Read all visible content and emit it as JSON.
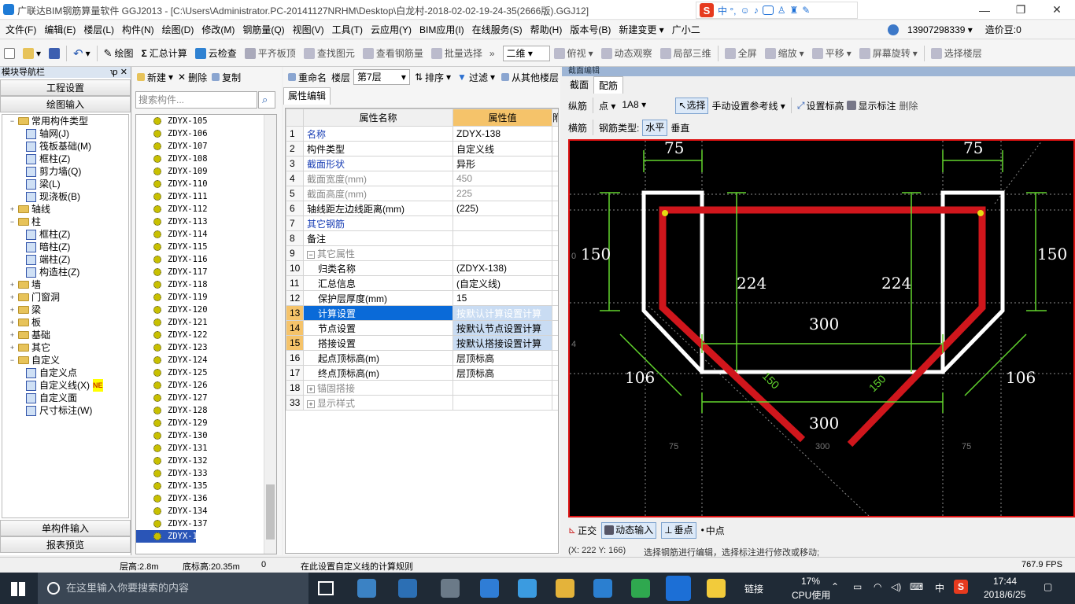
{
  "window": {
    "title": "广联达BIM钢筋算量软件 GGJ2013 - [C:\\Users\\Administrator.PC-20141127NRHM\\Desktop\\白龙村-2018-02-02-19-24-35(2666版).GGJ12]",
    "ime": "中 °,",
    "min": "—",
    "max": "❐",
    "close": "✕"
  },
  "menu": [
    "文件(F)",
    "编辑(E)",
    "楼层(L)",
    "构件(N)",
    "绘图(D)",
    "修改(M)",
    "钢筋量(Q)",
    "视图(V)",
    "工具(T)",
    "云应用(Y)",
    "BIM应用(I)",
    "在线服务(S)",
    "帮助(H)",
    "版本号(B)",
    "新建变更 ▾",
    "广小二"
  ],
  "menu_right": {
    "phone": "13907298339 ▾",
    "price": "造价豆:0"
  },
  "toolbar": {
    "draw": "绘图",
    "sum": "汇总计算",
    "cloud": "云检查",
    "flat": "平齐板顶",
    "find": "查找图元",
    "view_rebar": "查看钢筋量",
    "batch": "批量选择",
    "mode": "二维",
    "top": "俯视",
    "dyn": "动态观察",
    "local3d": "局部三维",
    "full": "全屏",
    "zoom": "缩放",
    "pan": "平移",
    "rotate": "屏幕旋转",
    "select_floor": "选择楼层"
  },
  "nav": {
    "title": "模块导航栏",
    "pin": "ꝕ ✕",
    "proj": "工程设置",
    "draw": "绘图输入",
    "single": "单构件输入",
    "report": "报表预览",
    "tree": [
      {
        "lvl": 0,
        "pm": "−",
        "label": "常用构件类型",
        "type": "folder"
      },
      {
        "lvl": 1,
        "label": "轴网(J)",
        "type": "comp"
      },
      {
        "lvl": 1,
        "label": "筏板基础(M)",
        "type": "comp"
      },
      {
        "lvl": 1,
        "label": "框柱(Z)",
        "type": "comp"
      },
      {
        "lvl": 1,
        "label": "剪力墙(Q)",
        "type": "comp"
      },
      {
        "lvl": 1,
        "label": "梁(L)",
        "type": "comp"
      },
      {
        "lvl": 1,
        "label": "现浇板(B)",
        "type": "comp"
      },
      {
        "lvl": 0,
        "pm": "+",
        "label": "轴线",
        "type": "folder"
      },
      {
        "lvl": 0,
        "pm": "−",
        "label": "柱",
        "type": "folder"
      },
      {
        "lvl": 1,
        "label": "框柱(Z)",
        "type": "comp"
      },
      {
        "lvl": 1,
        "label": "暗柱(Z)",
        "type": "comp"
      },
      {
        "lvl": 1,
        "label": "端柱(Z)",
        "type": "comp"
      },
      {
        "lvl": 1,
        "label": "构造柱(Z)",
        "type": "comp"
      },
      {
        "lvl": 0,
        "pm": "+",
        "label": "墙",
        "type": "folder"
      },
      {
        "lvl": 0,
        "pm": "+",
        "label": "门窗洞",
        "type": "folder"
      },
      {
        "lvl": 0,
        "pm": "+",
        "label": "梁",
        "type": "folder"
      },
      {
        "lvl": 0,
        "pm": "+",
        "label": "板",
        "type": "folder"
      },
      {
        "lvl": 0,
        "pm": "+",
        "label": "基础",
        "type": "folder"
      },
      {
        "lvl": 0,
        "pm": "+",
        "label": "其它",
        "type": "folder"
      },
      {
        "lvl": 0,
        "pm": "−",
        "label": "自定义",
        "type": "folder"
      },
      {
        "lvl": 1,
        "label": "自定义点",
        "type": "comp"
      },
      {
        "lvl": 1,
        "label": "自定义线(X)",
        "type": "comp",
        "badge": "NE"
      },
      {
        "lvl": 1,
        "label": "自定义面",
        "type": "comp"
      },
      {
        "lvl": 1,
        "label": "尺寸标注(W)",
        "type": "comp"
      }
    ]
  },
  "list": {
    "new": "新建",
    "del": "删除",
    "copy": "复制",
    "rename": "重命名",
    "floor_label": "楼层",
    "floor": "第7层",
    "sort": "排序",
    "filter": "过滤",
    "from_other": "从其他楼层",
    "search_placeholder": "搜索构件...",
    "items": [
      "ZDYX-105",
      "ZDYX-106",
      "ZDYX-107",
      "ZDYX-108",
      "ZDYX-109",
      "ZDYX-110",
      "ZDYX-111",
      "ZDYX-112",
      "ZDYX-113",
      "ZDYX-114",
      "ZDYX-115",
      "ZDYX-116",
      "ZDYX-117",
      "ZDYX-118",
      "ZDYX-119",
      "ZDYX-120",
      "ZDYX-121",
      "ZDYX-122",
      "ZDYX-123",
      "ZDYX-124",
      "ZDYX-125",
      "ZDYX-126",
      "ZDYX-127",
      "ZDYX-128",
      "ZDYX-129",
      "ZDYX-130",
      "ZDYX-131",
      "ZDYX-132",
      "ZDYX-133",
      "ZDYX-135",
      "ZDYX-136",
      "ZDYX-134",
      "ZDYX-137",
      "ZDYX-138"
    ],
    "selected": "ZDYX-138"
  },
  "props": {
    "tab": "属性编辑",
    "col_name": "属性名称",
    "col_val": "属性值",
    "col_extra": "附",
    "rows": [
      {
        "n": "1",
        "name": "名称",
        "val": "ZDYX-138",
        "cls": "blue"
      },
      {
        "n": "2",
        "name": "构件类型",
        "val": "自定义线"
      },
      {
        "n": "3",
        "name": "截面形状",
        "val": "异形",
        "cls": "blue"
      },
      {
        "n": "4",
        "name": "截面宽度(mm)",
        "val": "450",
        "cls": "grayt"
      },
      {
        "n": "5",
        "name": "截面高度(mm)",
        "val": "225",
        "cls": "grayt"
      },
      {
        "n": "6",
        "name": "轴线距左边线距离(mm)",
        "val": "(225)"
      },
      {
        "n": "7",
        "name": "其它钢筋",
        "val": "",
        "cls": "blue"
      },
      {
        "n": "8",
        "name": "备注",
        "val": ""
      },
      {
        "n": "9",
        "name": "其它属性",
        "val": "",
        "pm": "−",
        "cls": "grayt"
      },
      {
        "n": "10",
        "name": "归类名称",
        "val": "(ZDYX-138)",
        "indent": true
      },
      {
        "n": "11",
        "name": "汇总信息",
        "val": "(自定义线)",
        "indent": true
      },
      {
        "n": "12",
        "name": "保护层厚度(mm)",
        "val": "15",
        "indent": true
      },
      {
        "n": "13",
        "name": "计算设置",
        "val": "按默认计算设置计算",
        "indent": true,
        "sel": true,
        "hl": true
      },
      {
        "n": "14",
        "name": "节点设置",
        "val": "按默认节点设置计算",
        "indent": true,
        "hl": true
      },
      {
        "n": "15",
        "name": "搭接设置",
        "val": "按默认搭接设置计算",
        "indent": true,
        "hl": true
      },
      {
        "n": "16",
        "name": "起点顶标高(m)",
        "val": "层顶标高",
        "indent": true
      },
      {
        "n": "17",
        "name": "终点顶标高(m)",
        "val": "层顶标高",
        "indent": true
      },
      {
        "n": "18",
        "name": "锚固搭接",
        "val": "",
        "pm": "+",
        "cls": "grayt"
      },
      {
        "n": "33",
        "name": "显示样式",
        "val": "",
        "pm": "+",
        "cls": "grayt"
      }
    ]
  },
  "drawing": {
    "title": "截面编辑",
    "tab_section": "截面",
    "tab_rebar": "配筋",
    "longi": "纵筋",
    "point": "点 ▾",
    "spec": "1A8",
    "select": "选择",
    "manual_ref": "手动设置参考线",
    "set_elev": "设置标高",
    "show_label": "显示标注",
    "delete": "删除",
    "stirrup": "横筋",
    "rebar_type": "钢筋类型:",
    "horizontal": "水平",
    "vertical": "垂直",
    "dims": {
      "d75a": "75",
      "d75b": "75",
      "d150a": "150",
      "d150b": "150",
      "d224a": "224",
      "d224b": "224",
      "d300a": "300",
      "d300b": "300",
      "d106a": "106",
      "d106b": "106",
      "d150c": "150",
      "d150d": "150",
      "g75a": "75",
      "g300": "300",
      "g75b": "75",
      "g0": "0",
      "g4": "4"
    },
    "ortho": "正交",
    "dyn_input": "动态输入",
    "perp": "垂点",
    "mid": "中点",
    "coord": "(X: 222 Y: 166)",
    "hint": "选择钢筋进行编辑，选择标注进行修改或移动;"
  },
  "status": {
    "floor_h": "层高:2.8m",
    "base_h": "底标高:20.35m",
    "zero": "0",
    "msg": "在此设置自定义线的计算规则",
    "fps": "767.9 FPS"
  },
  "taskbar": {
    "search": "在这里输入你要搜索的内容",
    "link": "链接",
    "cpu": "17%",
    "cpu_label": "CPU使用",
    "lang": "中",
    "time": "17:44",
    "date": "2018/6/25"
  }
}
